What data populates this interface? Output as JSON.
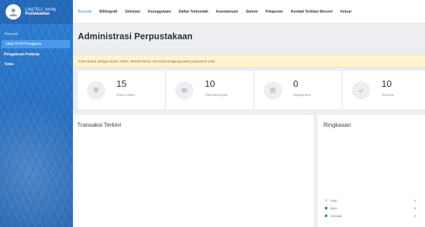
{
  "user": {
    "name": "Libg7512_sendy",
    "role": "Pustakawan"
  },
  "sidebar": {
    "section_label": "Personal",
    "items": [
      {
        "label": "Ubah Profil Pengguna",
        "active": true
      },
      {
        "label": "Pengaturan Peminta",
        "active": false
      },
      {
        "label": "Tema",
        "active": false
      }
    ]
  },
  "nav": [
    {
      "label": "Beranda",
      "active": true
    },
    {
      "label": "Bibliografi",
      "active": false
    },
    {
      "label": "Sirkulasi",
      "active": false
    },
    {
      "label": "Keanggotaan",
      "active": false
    },
    {
      "label": "Daftar Terkendali",
      "active": false
    },
    {
      "label": "Inventarisasi",
      "active": false
    },
    {
      "label": "Sistem",
      "active": false
    },
    {
      "label": "Pelaporan",
      "active": false
    },
    {
      "label": "Kendali Terbitan Berseri",
      "active": false
    },
    {
      "label": "Keluar",
      "active": false
    }
  ],
  "page": {
    "title": "Administrasi Perpustakaan",
    "alert": "Anda masuk sebagai Super Admin. Otoritas besar, menuntut tanggung jawab yang besar pula."
  },
  "stats": [
    {
      "value": "15",
      "label": "Total Koleksi",
      "icon": "book-icon"
    },
    {
      "value": "10",
      "label": "Total Eksemplar",
      "icon": "stack-icon"
    },
    {
      "value": "0",
      "label": "Dipinjamkan",
      "icon": "inbox-icon"
    },
    {
      "value": "10",
      "label": "Tersedia",
      "icon": "check-icon"
    }
  ],
  "panels": {
    "transactions_title": "Transaksi Terkini",
    "summary_title": "Ringkasan"
  },
  "summary_legend": [
    {
      "label": "Total",
      "count": "0",
      "color": "#d9dde2"
    },
    {
      "label": "Baru",
      "count": "0",
      "color": "#4a7bd8"
    },
    {
      "label": "Kembali",
      "count": "0",
      "color": "#2a9a8c"
    }
  ]
}
